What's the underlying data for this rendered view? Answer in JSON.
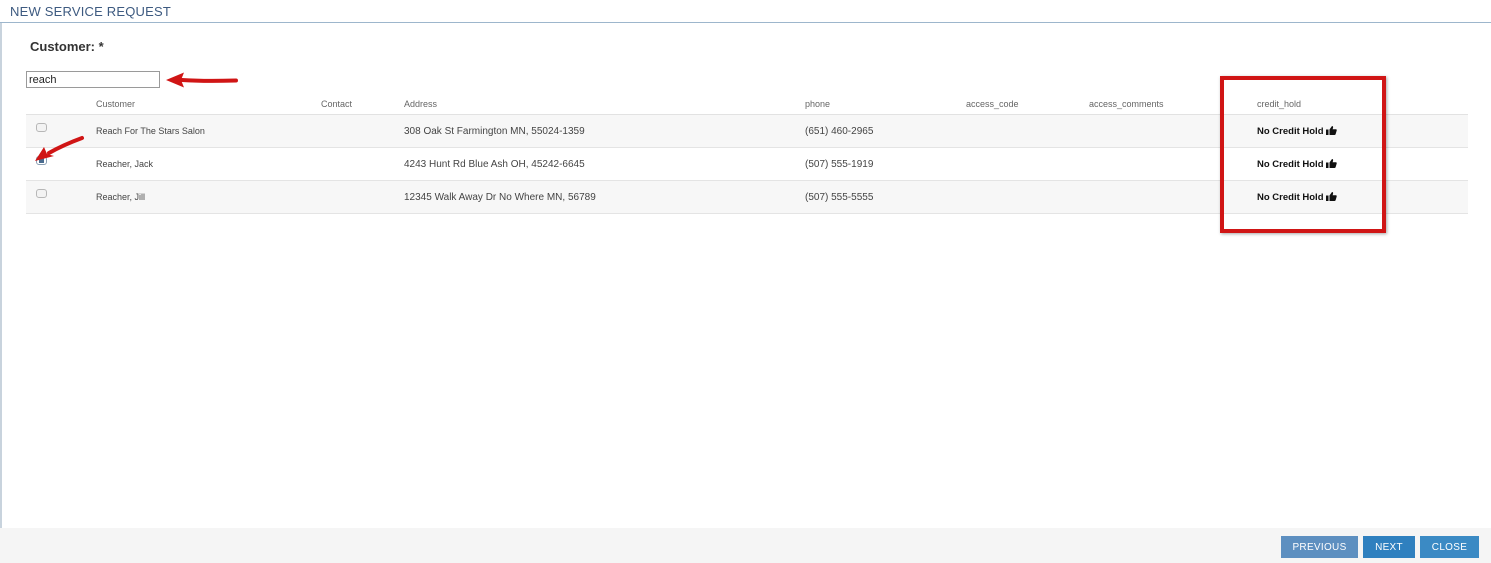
{
  "window": {
    "title": "NEW SERVICE REQUEST"
  },
  "form": {
    "customer_label": "Customer: *",
    "search_value": "reach"
  },
  "table": {
    "columns": [
      "Customer",
      "Contact",
      "Address",
      "phone",
      "access_code",
      "access_comments",
      "credit_hold"
    ],
    "rows": [
      {
        "checked": false,
        "customer": "Reach For The Stars Salon",
        "contact": "",
        "address": "308 Oak St Farmington MN, 55024-1359",
        "phone": "(651) 460-2965",
        "access_code": "",
        "access_comments": "",
        "credit_hold": "No Credit Hold"
      },
      {
        "checked": true,
        "customer": "Reacher, Jack",
        "contact": "",
        "address": "4243 Hunt Rd Blue Ash OH, 45242-6645",
        "phone": "(507) 555-1919",
        "access_code": "",
        "access_comments": "",
        "credit_hold": "No Credit Hold"
      },
      {
        "checked": false,
        "customer": "Reacher, Jill",
        "contact": "",
        "address": "12345 Walk Away Dr No Where MN, 56789",
        "phone": "(507) 555-5555",
        "access_code": "",
        "access_comments": "",
        "credit_hold": "No Credit Hold"
      }
    ]
  },
  "footer": {
    "previous_label": "PREVIOUS",
    "next_label": "NEXT",
    "close_label": "CLOSE"
  },
  "icons": {
    "credit_hold_icon": "thumbs-up-icon"
  },
  "colors": {
    "annotation": "#d01515",
    "title": "#3d5a80",
    "button_primary": "#2f80bf"
  }
}
